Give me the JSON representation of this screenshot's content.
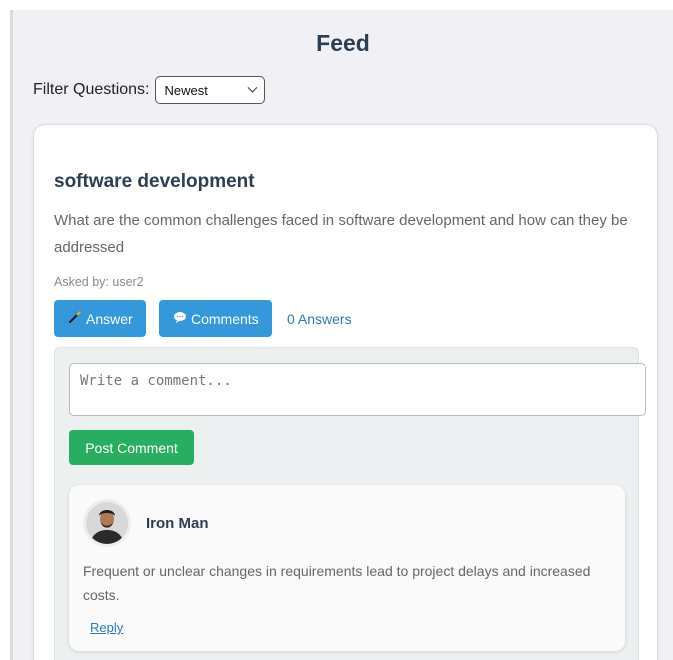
{
  "header": {
    "title": "Feed"
  },
  "filter": {
    "label": "Filter Questions:",
    "selected": "Newest"
  },
  "question": {
    "title": "software development",
    "text": "What are the common challenges faced in software development and how can they be addressed",
    "asked_by": "Asked by: user2",
    "answer_label": "Answer",
    "comments_label": "Comments",
    "answers_count": "0 Answers"
  },
  "comment_form": {
    "placeholder": "Write a comment...",
    "post_label": "Post Comment"
  },
  "comments": [
    {
      "author": "Iron Man",
      "text": "Frequent or unclear changes in requirements lead to project delays and increased costs.",
      "reply_label": "Reply"
    }
  ],
  "colors": {
    "primary": "#3498db",
    "success": "#27ae60",
    "heading": "#2c3e50",
    "link": "#2a7ab8"
  },
  "icons": {
    "answer": "pencil-icon",
    "comments": "speech-bubble-icon"
  }
}
